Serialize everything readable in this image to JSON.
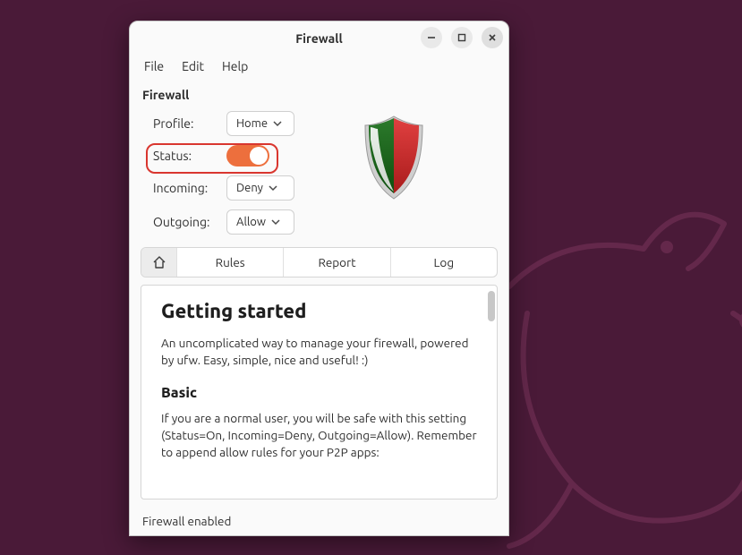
{
  "window": {
    "title": "Firewall"
  },
  "menubar": {
    "file": "File",
    "edit": "Edit",
    "help": "Help"
  },
  "section": {
    "title": "Firewall"
  },
  "settings": {
    "profile_label": "Profile:",
    "profile_value": "Home",
    "status_label": "Status:",
    "status_on": true,
    "incoming_label": "Incoming:",
    "incoming_value": "Deny",
    "outgoing_label": "Outgoing:",
    "outgoing_value": "Allow"
  },
  "tabs": {
    "rules": "Rules",
    "report": "Report",
    "log": "Log"
  },
  "content": {
    "h1": "Getting started",
    "p1": "An uncomplicated way to manage your firewall, powered by ufw. Easy, simple, nice and useful! :)",
    "h2": "Basic",
    "p2": "If you are a normal user, you will be safe with this setting (Status=On, Incoming=Deny, Outgoing=Allow). Remember to append allow rules for your P2P apps:"
  },
  "statusbar": {
    "text": "Firewall enabled"
  }
}
